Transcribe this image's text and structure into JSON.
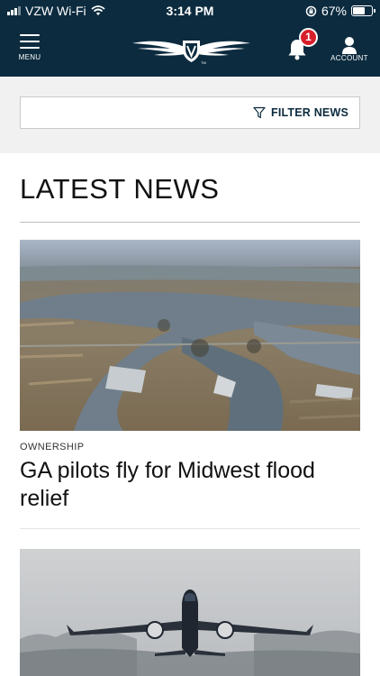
{
  "status_bar": {
    "carrier": "VZW Wi-Fi",
    "time": "3:14 PM",
    "battery": "67%",
    "battery_level": 0.67
  },
  "header": {
    "menu_label": "MENU",
    "account_label": "ACCOUNT",
    "notification_count": "1",
    "logo_icon": "winged-shield-logo",
    "logo_mark": "TM"
  },
  "filter": {
    "label": "FILTER NEWS",
    "icon": "filter-funnel-icon"
  },
  "section": {
    "title": "LATEST NEWS"
  },
  "articles": [
    {
      "category": "OWNERSHIP",
      "headline": "GA pilots fly for Midwest flood relief",
      "image": "aerial-flooded-river-photo"
    },
    {
      "image": "airliner-takeoff-photo"
    }
  ],
  "colors": {
    "header_bg": "#0c2b3f",
    "badge": "#d8202c",
    "filter_bg": "#f1f1f2"
  }
}
